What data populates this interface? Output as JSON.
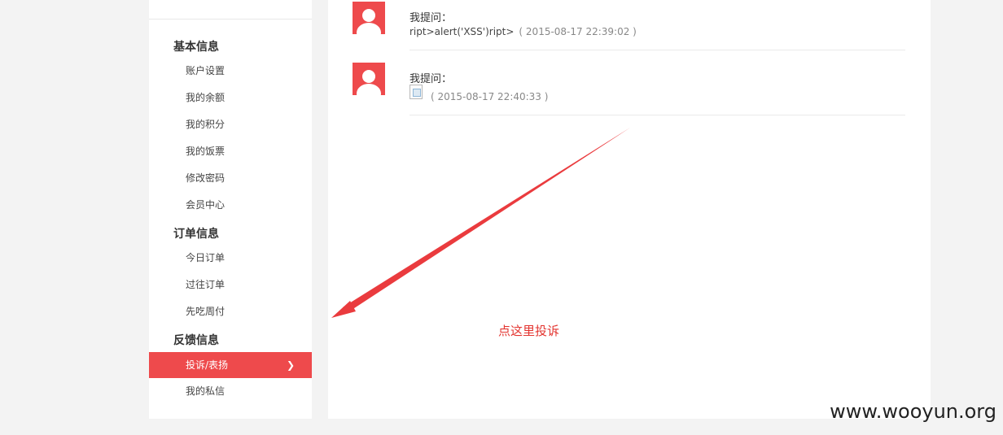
{
  "sidebar": {
    "sections": [
      {
        "title": "基本信息",
        "items": [
          "账户设置",
          "我的余额",
          "我的积分",
          "我的饭票",
          "修改密码",
          "会员中心"
        ]
      },
      {
        "title": "订单信息",
        "items": [
          "今日订单",
          "过往订单",
          "先吃周付"
        ]
      },
      {
        "title": "反馈信息",
        "items": [
          "投诉/表扬",
          "我的私信"
        ]
      }
    ],
    "active_chevron": "❯"
  },
  "questions": [
    {
      "label": "我提问：",
      "body": "ript>alert('XSS')ript>",
      "time": "( 2015-08-17 22:39:02 )"
    },
    {
      "label": "我提问：",
      "body": "",
      "time": "( 2015-08-17 22:40:33 )"
    }
  ],
  "annotation": {
    "text": "点这里投诉",
    "color": "#e3342f"
  },
  "watermark": "www.wooyun.org",
  "colors": {
    "accent": "#ee4a4c",
    "background": "#f3f3f3"
  }
}
